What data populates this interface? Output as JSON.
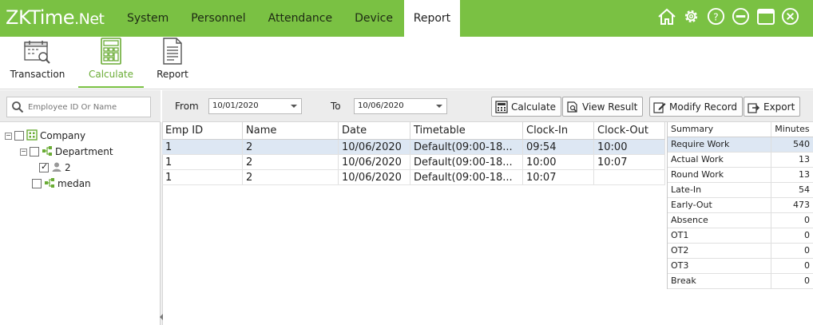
{
  "app": {
    "logo_main": "ZKTime",
    "logo_net": ".Net"
  },
  "menu": [
    {
      "label": "System"
    },
    {
      "label": "Personnel"
    },
    {
      "label": "Attendance"
    },
    {
      "label": "Device"
    },
    {
      "label": "Report",
      "active": true
    }
  ],
  "window_icons": [
    "home-icon",
    "gear-icon",
    "help-icon",
    "minimize-icon",
    "maximize-icon",
    "close-icon"
  ],
  "toolbar": [
    {
      "label": "Transaction",
      "icon": "transaction-icon"
    },
    {
      "label": "Calculate",
      "icon": "calculator-icon",
      "active": true
    },
    {
      "label": "Report",
      "icon": "report-icon"
    }
  ],
  "search": {
    "placeholder": "Employee ID Or Name"
  },
  "tree": {
    "root": "Company",
    "department": "Department",
    "employee": "2",
    "branch": "medan"
  },
  "filter": {
    "from_label": "From",
    "from_value": "10/01/2020",
    "to_label": "To",
    "to_value": "10/06/2020"
  },
  "actions": {
    "calculate": "Calculate",
    "view_result": "View Result",
    "modify_record": "Modify Record",
    "export": "Export"
  },
  "table": {
    "headers": [
      "Emp ID",
      "Name",
      "Date",
      "Timetable",
      "Clock-In",
      "Clock-Out"
    ],
    "rows": [
      [
        "1",
        "2",
        "10/06/2020",
        "Default(09:00-18...",
        "09:54",
        "10:00"
      ],
      [
        "1",
        "2",
        "10/06/2020",
        "Default(09:00-18...",
        "10:00",
        "10:07"
      ],
      [
        "1",
        "2",
        "10/06/2020",
        "Default(09:00-18...",
        "10:07",
        ""
      ]
    ]
  },
  "summary": {
    "headers": [
      "Summary",
      "Minutes"
    ],
    "rows": [
      [
        "Require Work",
        "540"
      ],
      [
        "Actual Work",
        "13"
      ],
      [
        "Round Work",
        "13"
      ],
      [
        "Late-In",
        "54"
      ],
      [
        "Early-Out",
        "473"
      ],
      [
        "Absence",
        "0"
      ],
      [
        "OT1",
        "0"
      ],
      [
        "OT2",
        "0"
      ],
      [
        "OT3",
        "0"
      ],
      [
        "Break",
        "0"
      ]
    ]
  },
  "colors": {
    "brand": "#7ac143",
    "selection": "#dde7f3"
  }
}
